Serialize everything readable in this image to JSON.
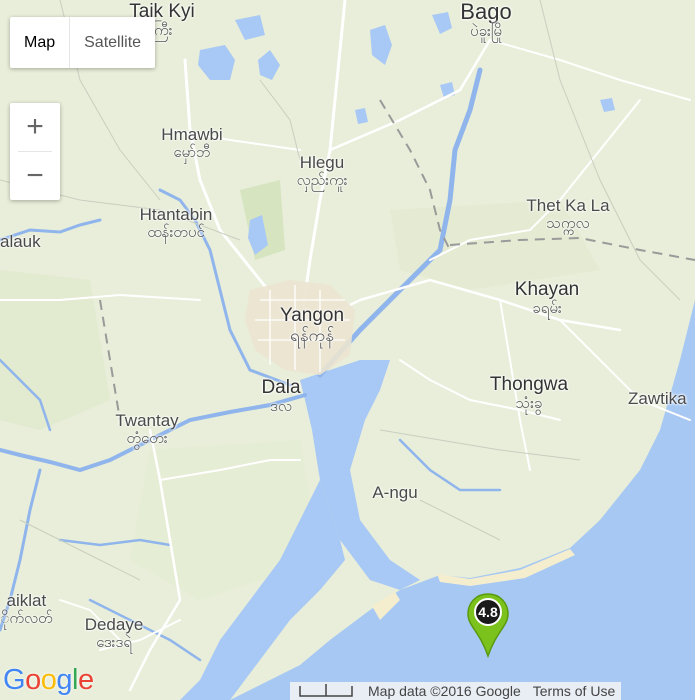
{
  "map_type_control": {
    "map_label": "Map",
    "satellite_label": "Satellite",
    "selected": "Map"
  },
  "zoom_control": {
    "in_label": "+",
    "out_label": "−"
  },
  "places": {
    "taik_kyi": {
      "en": "Taik Kyi",
      "my": "ကြီး"
    },
    "bago": {
      "en": "Bago",
      "my": "ပဲခူးမြို"
    },
    "hmawbi": {
      "en": "Hmawbi",
      "my": "မှော်ဘီ"
    },
    "hlegu": {
      "en": "Hlegu",
      "my": "လှည်းကူး"
    },
    "htantabin": {
      "en": "Htantabin",
      "my": "ထန်းတပင်"
    },
    "alauk": {
      "en": "alauk"
    },
    "thet_ka_la": {
      "en": "Thet Ka La",
      "my": "သက္ကလ"
    },
    "yangon": {
      "en": "Yangon",
      "my": "ရန်ကုန်"
    },
    "khayan": {
      "en": "Khayan",
      "my": "ခရမ်း"
    },
    "dala": {
      "en": "Dala",
      "my": "ဒလ"
    },
    "thongwa": {
      "en": "Thongwa",
      "my": "သုံးခွ"
    },
    "zawtika": {
      "en": "Zawtika"
    },
    "twantay": {
      "en": "Twantay",
      "my": "တွံတေး"
    },
    "a_ngu": {
      "en": "A-ngu"
    },
    "aiklat": {
      "en": "aiklat",
      "my": "ိုက်လတ်"
    },
    "dedaye": {
      "en": "Dedaye",
      "my": "ဒေးဒရဲ"
    }
  },
  "marker": {
    "label": "4.8",
    "color": "#7cc21c",
    "icon": "map-pin-icon"
  },
  "logo": {
    "text": "Google",
    "colors": [
      "#4285f4",
      "#ea4335",
      "#fbbc05",
      "#4285f4",
      "#34a853",
      "#ea4335"
    ]
  },
  "footer": {
    "map_data": "Map data ©2016 Google",
    "terms": "Terms of Use"
  },
  "colors": {
    "land": "#e8eed9",
    "water": "#a8c8f5",
    "sea": "#a7c8f3",
    "river": "#8fb5ec",
    "road": "#ffffff",
    "boundary": "#9a9a9a",
    "beach": "#f4eecf"
  }
}
